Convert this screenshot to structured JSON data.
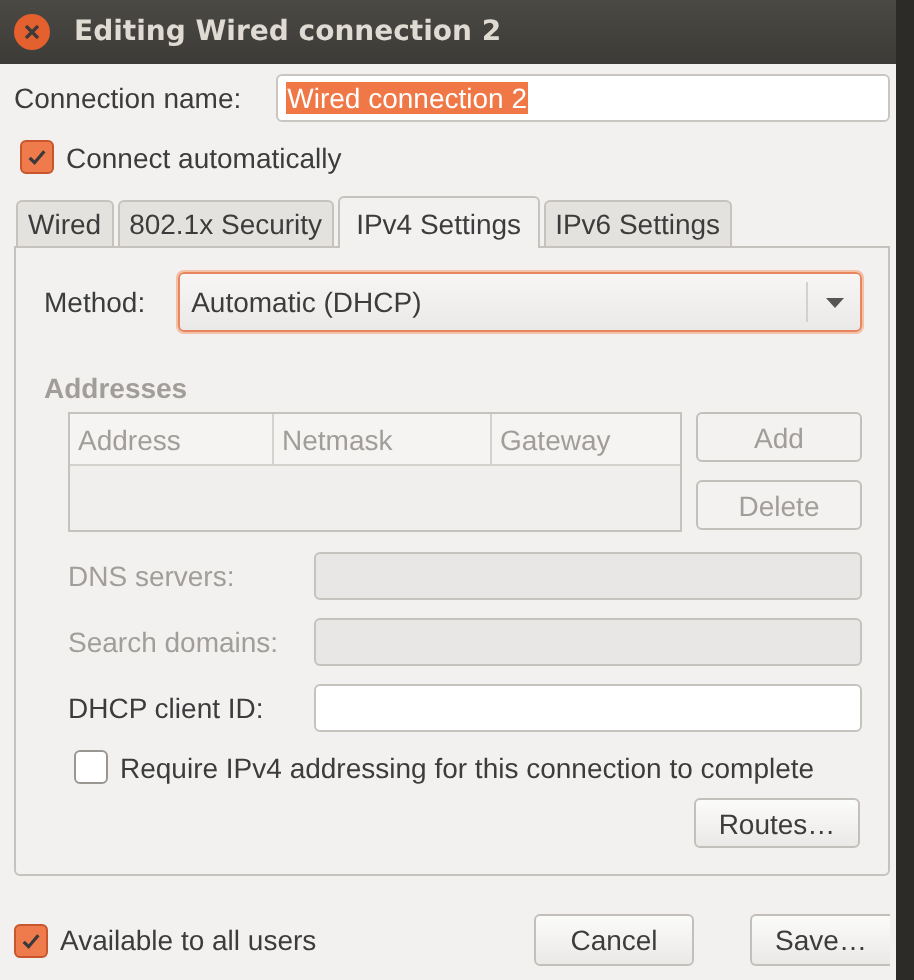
{
  "window": {
    "title": "Editing Wired connection 2"
  },
  "connection_name": {
    "label": "Connection name:",
    "value": "Wired connection 2",
    "text_selected": true
  },
  "connect_automatically": {
    "label": "Connect automatically",
    "checked": true
  },
  "tabs": [
    {
      "label": "Wired",
      "selected": false
    },
    {
      "label": "802.1x Security",
      "selected": false
    },
    {
      "label": "IPv4 Settings",
      "selected": true
    },
    {
      "label": "IPv6 Settings",
      "selected": false
    }
  ],
  "ipv4": {
    "method": {
      "label": "Method:",
      "value": "Automatic (DHCP)"
    },
    "addresses": {
      "heading": "Addresses",
      "disabled": true,
      "columns": [
        "Address",
        "Netmask",
        "Gateway"
      ],
      "buttons": [
        {
          "label": "Add",
          "disabled": true
        },
        {
          "label": "Delete",
          "disabled": true
        }
      ]
    },
    "fields": [
      {
        "label": "DNS servers:",
        "disabled": true
      },
      {
        "label": "Search domains:",
        "disabled": true
      },
      {
        "label": "DHCP client ID:",
        "disabled": false
      }
    ],
    "require": {
      "label": "Require IPv4 addressing for this connection to complete",
      "checked": false
    },
    "routes_button": "Routes…"
  },
  "available_to_all_users": {
    "label": "Available to all users",
    "checked": true
  },
  "buttons": [
    {
      "label": "Cancel"
    },
    {
      "label": "Save…"
    }
  ]
}
